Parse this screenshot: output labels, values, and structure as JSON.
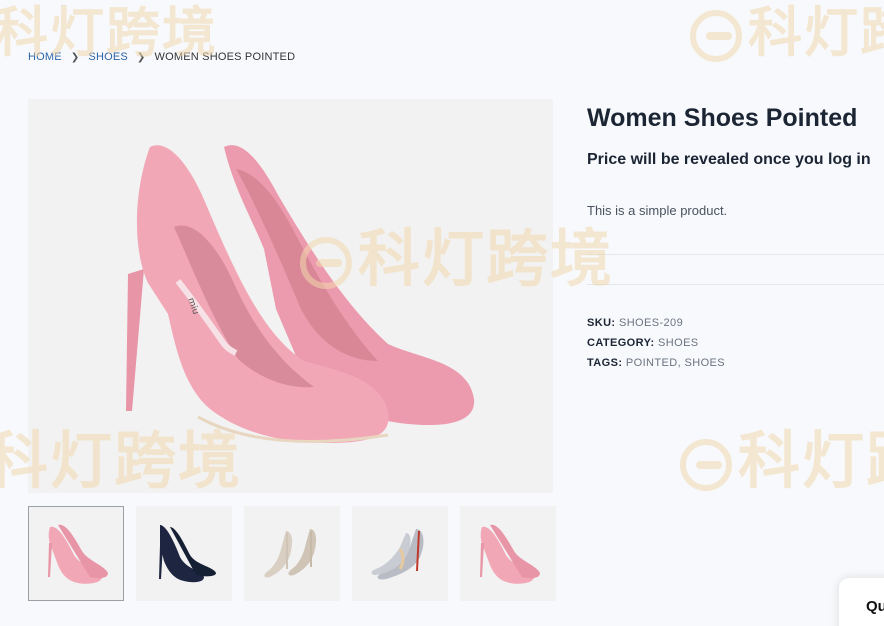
{
  "breadcrumb": {
    "home": "HOME",
    "category": "SHOES",
    "current": "WOMEN SHOES POINTED"
  },
  "product": {
    "title": "Women Shoes Pointed",
    "price_note": "Price will be revealed once you log in",
    "short_description": "This is a simple product.",
    "sku_label": "SKU:",
    "sku": "SHOES-209",
    "category_label": "CATEGORY:",
    "category": "SHOES",
    "tags_label": "TAGS:",
    "tags": [
      "POINTED",
      "SHOES"
    ],
    "tag_separator": ","
  },
  "gallery": {
    "thumbnails": [
      {
        "name": "pink-suede-pumps",
        "color": "#f2a7b6",
        "active": true
      },
      {
        "name": "navy-suede-pumps",
        "color": "#1d2540",
        "active": false
      },
      {
        "name": "beige-pumps",
        "color": "#d9cfc3",
        "active": false
      },
      {
        "name": "silver-glitter-pumps",
        "color": "#b9bcc4",
        "active": false
      },
      {
        "name": "pink-pumps-alt",
        "color": "#f2a7b6",
        "active": false
      }
    ]
  },
  "watermark": {
    "text": "科灯跨境"
  },
  "floating_button": {
    "label": "Qu"
  },
  "colors": {
    "link": "#2b63a8",
    "heading": "#1b2534",
    "meta_value": "#6b7380",
    "shoe_pink": "#f2a7b6",
    "watermark": "#f3d9ae"
  }
}
